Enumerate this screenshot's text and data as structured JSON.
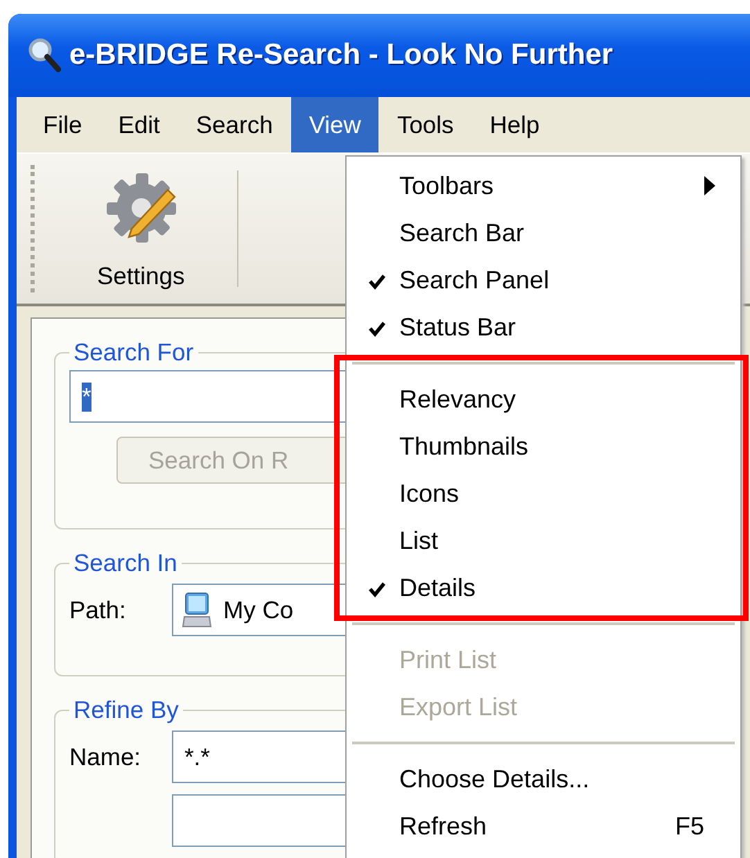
{
  "window": {
    "title": "e-BRIDGE Re-Search - Look No Further"
  },
  "menu_bar": [
    {
      "label": "File",
      "selected": false
    },
    {
      "label": "Edit",
      "selected": false
    },
    {
      "label": "Search",
      "selected": false
    },
    {
      "label": "View",
      "selected": true
    },
    {
      "label": "Tools",
      "selected": false
    },
    {
      "label": "Help",
      "selected": false
    }
  ],
  "toolbar": {
    "buttons": [
      {
        "label": "Settings"
      }
    ]
  },
  "search_panel": {
    "search_for": {
      "title": "Search For",
      "value": "*",
      "value_selected": true,
      "button": "Search On R"
    },
    "search_in": {
      "title": "Search In",
      "path_label": "Path:",
      "path_value": "My Co"
    },
    "refine_by": {
      "title": "Refine By",
      "name_label": "Name:",
      "name_value": "*.*"
    }
  },
  "view_menu": {
    "sections": [
      {
        "highlighted": false,
        "items": [
          {
            "label": "Toolbars",
            "checked": false,
            "disabled": false,
            "submenu": true
          },
          {
            "label": "Search Bar",
            "checked": false,
            "disabled": false,
            "submenu": false
          },
          {
            "label": "Search Panel",
            "checked": true,
            "disabled": false,
            "submenu": false
          },
          {
            "label": "Status Bar",
            "checked": true,
            "disabled": false,
            "submenu": false
          }
        ]
      },
      {
        "highlighted": true,
        "items": [
          {
            "label": "Relevancy",
            "checked": false,
            "disabled": false,
            "submenu": false
          },
          {
            "label": "Thumbnails",
            "checked": false,
            "disabled": false,
            "submenu": false
          },
          {
            "label": "Icons",
            "checked": false,
            "disabled": false,
            "submenu": false
          },
          {
            "label": "List",
            "checked": false,
            "disabled": false,
            "submenu": false
          },
          {
            "label": "Details",
            "checked": true,
            "disabled": false,
            "submenu": false
          }
        ]
      },
      {
        "highlighted": false,
        "items": [
          {
            "label": "Print List",
            "checked": false,
            "disabled": true,
            "submenu": false
          },
          {
            "label": "Export List",
            "checked": false,
            "disabled": true,
            "submenu": false
          }
        ]
      },
      {
        "highlighted": false,
        "items": [
          {
            "label": "Choose Details...",
            "checked": false,
            "disabled": false,
            "submenu": false
          },
          {
            "label": "Refresh",
            "checked": false,
            "disabled": false,
            "submenu": false,
            "shortcut": "F5"
          }
        ]
      }
    ]
  }
}
